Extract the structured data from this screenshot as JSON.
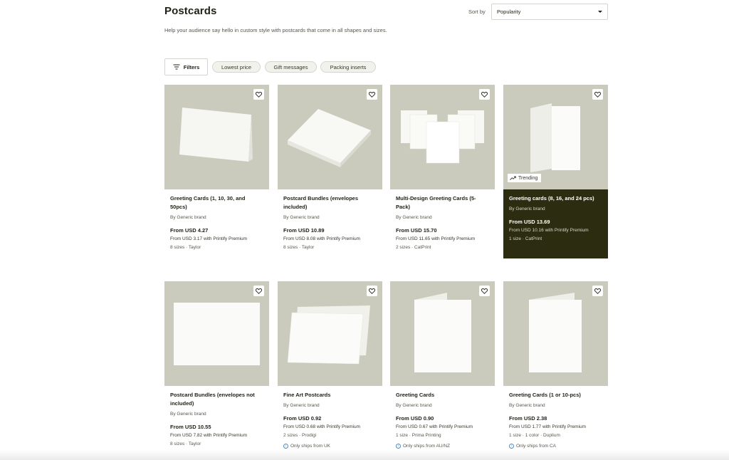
{
  "header": {
    "title": "Postcards",
    "subtitle": "Help your audience say hello in custom style with postcards that come in all shapes and sizes.",
    "sort_label": "Sort by",
    "sort_value": "Popularity"
  },
  "filters": {
    "button_label": "Filters",
    "chips": [
      "Lowest price",
      "Gift messages",
      "Packing inserts"
    ]
  },
  "products": [
    {
      "title": "Greeting Cards (1, 10, 30, and 50pcs)",
      "brand": "By Generic brand",
      "price": "From USD 4.27",
      "premium": "From USD 3.17 with Printify Premium",
      "meta": "8 sizes · Taylor"
    },
    {
      "title": "Postcard Bundles (envelopes included)",
      "brand": "By Generic brand",
      "price": "From USD 10.89",
      "premium": "From USD 8.08 with Printify Premium",
      "meta": "8 sizes · Taylor"
    },
    {
      "title": "Multi-Design Greeting Cards (5-Pack)",
      "brand": "By Generic brand",
      "price": "From USD 15.70",
      "premium": "From USD 11.65 with Printify Premium",
      "meta": "2 sizes · CatPrint"
    },
    {
      "title": "Greeting cards (8, 16, and 24 pcs)",
      "brand": "By Generic brand",
      "price": "From USD 13.69",
      "premium": "From USD 10.16 with Printify Premium",
      "meta": "1 size · CatPrint",
      "badge": "Trending"
    },
    {
      "title": "Postcard Bundles (envelopes not included)",
      "brand": "By Generic brand",
      "price": "From USD 10.55",
      "premium": "From USD 7.82 with Printify Premium",
      "meta": "8 sizes · Taylor"
    },
    {
      "title": "Fine Art Postcards",
      "brand": "By Generic brand",
      "price": "From USD 0.92",
      "premium": "From USD 0.68 with Printify Premium",
      "meta": "2 sizes · Prodigi",
      "ships": "Only ships from UK"
    },
    {
      "title": "Greeting Cards",
      "brand": "By Generic brand",
      "price": "From USD 0.90",
      "premium": "From USD 0.67 with Printify Premium",
      "meta": "1 size · Prima Printing",
      "ships": "Only ships from AU/NZ"
    },
    {
      "title": "Greeting Cards (1 or 10-pcs)",
      "brand": "By Generic brand",
      "price": "From USD 2.38",
      "premium": "From USD 1.77 with Printify Premium",
      "meta": "1 size · 1 color · Duplium",
      "ships": "Only ships from CA"
    }
  ],
  "colors": {
    "thumb_background": "#cacbbd",
    "featured_card": "#2c2c10",
    "text_primary": "#1f2116",
    "info_blue": "#4a8bc9"
  }
}
